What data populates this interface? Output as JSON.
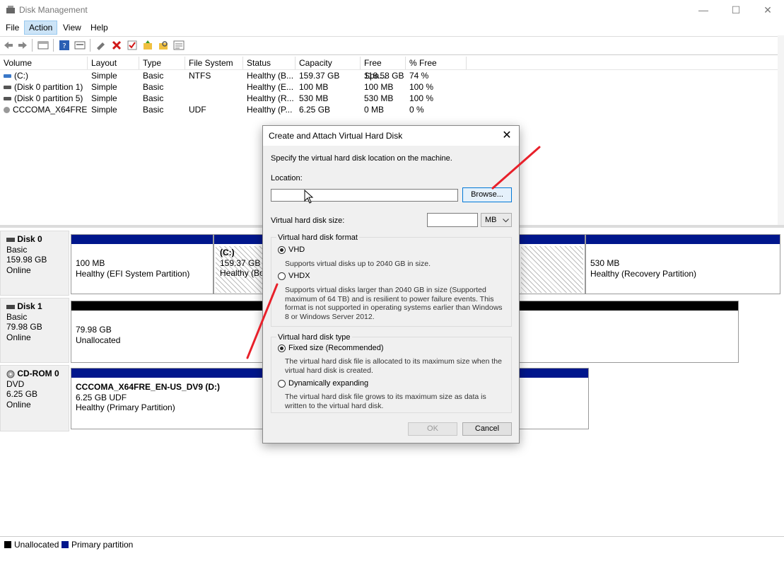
{
  "window": {
    "title": "Disk Management",
    "minimize": "—",
    "maximize": "☐",
    "close": "✕"
  },
  "menu": {
    "file": "File",
    "action": "Action",
    "view": "View",
    "help": "Help"
  },
  "volume_table": {
    "columns": [
      "Volume",
      "Layout",
      "Type",
      "File System",
      "Status",
      "Capacity",
      "Free Spa...",
      "% Free"
    ],
    "rows": [
      {
        "volume": "(C:)",
        "layout": "Simple",
        "type": "Basic",
        "fs": "NTFS",
        "status": "Healthy (B...",
        "capacity": "159.37 GB",
        "free": "118.58 GB",
        "pct": "74 %"
      },
      {
        "volume": "(Disk 0 partition 1)",
        "layout": "Simple",
        "type": "Basic",
        "fs": "",
        "status": "Healthy (E...",
        "capacity": "100 MB",
        "free": "100 MB",
        "pct": "100 %"
      },
      {
        "volume": "(Disk 0 partition 5)",
        "layout": "Simple",
        "type": "Basic",
        "fs": "",
        "status": "Healthy (R...",
        "capacity": "530 MB",
        "free": "530 MB",
        "pct": "100 %"
      },
      {
        "volume": "CCCOMA_X64FRE...",
        "layout": "Simple",
        "type": "Basic",
        "fs": "UDF",
        "status": "Healthy (P...",
        "capacity": "6.25 GB",
        "free": "0 MB",
        "pct": "0 %"
      }
    ]
  },
  "disks": {
    "disk0": {
      "name": "Disk 0",
      "kind": "Basic",
      "size": "159.98 GB",
      "state": "Online",
      "p1_size": "100 MB",
      "p1_status": "Healthy (EFI System Partition)",
      "p2_label": "(C:)",
      "p2_size": "159.37 GB N",
      "p2_status": "Healthy (Boo",
      "p3_size": "530 MB",
      "p3_status": "Healthy (Recovery Partition)"
    },
    "disk1": {
      "name": "Disk 1",
      "kind": "Basic",
      "size": "79.98 GB",
      "state": "Online",
      "p1_size": "79.98 GB",
      "p1_status": "Unallocated"
    },
    "cdrom0": {
      "name": "CD-ROM 0",
      "kind": "DVD",
      "size": "6.25 GB",
      "state": "Online",
      "p1_label": "CCCOMA_X64FRE_EN-US_DV9  (D:)",
      "p1_size": "6.25 GB UDF",
      "p1_status": "Healthy (Primary Partition)"
    }
  },
  "legend": {
    "unallocated": "Unallocated",
    "primary": "Primary partition"
  },
  "colors": {
    "primary_partition": "#00168c",
    "unallocated": "#000000",
    "annotation": "#e8202a",
    "selection": "#cce4f7"
  },
  "dialog": {
    "title": "Create and Attach Virtual Hard Disk",
    "close": "✕",
    "intro": "Specify the virtual hard disk location on the machine.",
    "location_label": "Location:",
    "location_value": "",
    "browse_button": "Browse...",
    "size_label": "Virtual hard disk size:",
    "size_value": "",
    "size_unit": "MB",
    "format_group": "Virtual hard disk format",
    "vhd_label": "VHD",
    "vhd_desc": "Supports virtual disks up to 2040 GB in size.",
    "vhdx_label": "VHDX",
    "vhdx_desc": "Supports virtual disks larger than 2040 GB in size (Supported maximum of 64 TB) and is resilient to power failure events. This format is not supported in operating systems earlier than Windows 8 or Windows Server 2012.",
    "type_group": "Virtual hard disk type",
    "fixed_label": "Fixed size (Recommended)",
    "fixed_desc": "The virtual hard disk file is allocated to its maximum size when the virtual hard disk is created.",
    "dynamic_label": "Dynamically expanding",
    "dynamic_desc": "The virtual hard disk file grows to its maximum size as data is written to the virtual hard disk.",
    "ok_button": "OK",
    "cancel_button": "Cancel",
    "selected_format": "VHD",
    "selected_type": "Fixed size (Recommended)"
  }
}
